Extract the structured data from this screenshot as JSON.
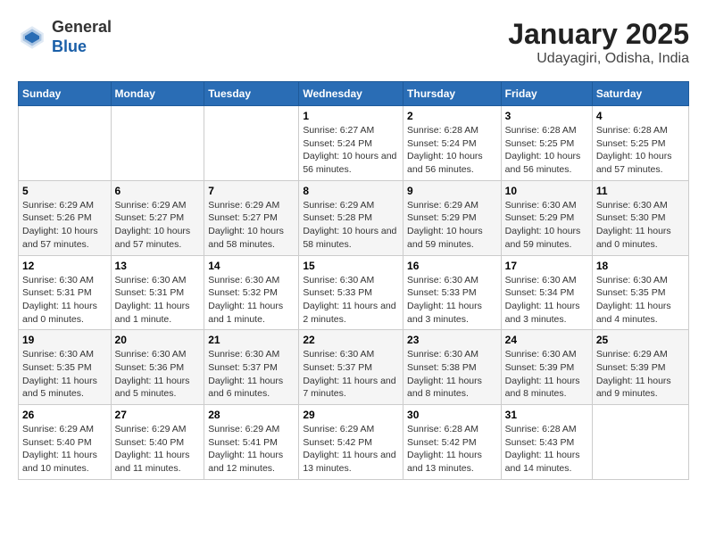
{
  "header": {
    "logo_line1": "General",
    "logo_line2": "Blue",
    "title": "January 2025",
    "subtitle": "Udayagiri, Odisha, India"
  },
  "weekdays": [
    "Sunday",
    "Monday",
    "Tuesday",
    "Wednesday",
    "Thursday",
    "Friday",
    "Saturday"
  ],
  "weeks": [
    [
      {
        "day": "",
        "info": ""
      },
      {
        "day": "",
        "info": ""
      },
      {
        "day": "",
        "info": ""
      },
      {
        "day": "1",
        "info": "Sunrise: 6:27 AM\nSunset: 5:24 PM\nDaylight: 10 hours and 56 minutes."
      },
      {
        "day": "2",
        "info": "Sunrise: 6:28 AM\nSunset: 5:24 PM\nDaylight: 10 hours and 56 minutes."
      },
      {
        "day": "3",
        "info": "Sunrise: 6:28 AM\nSunset: 5:25 PM\nDaylight: 10 hours and 56 minutes."
      },
      {
        "day": "4",
        "info": "Sunrise: 6:28 AM\nSunset: 5:25 PM\nDaylight: 10 hours and 57 minutes."
      }
    ],
    [
      {
        "day": "5",
        "info": "Sunrise: 6:29 AM\nSunset: 5:26 PM\nDaylight: 10 hours and 57 minutes."
      },
      {
        "day": "6",
        "info": "Sunrise: 6:29 AM\nSunset: 5:27 PM\nDaylight: 10 hours and 57 minutes."
      },
      {
        "day": "7",
        "info": "Sunrise: 6:29 AM\nSunset: 5:27 PM\nDaylight: 10 hours and 58 minutes."
      },
      {
        "day": "8",
        "info": "Sunrise: 6:29 AM\nSunset: 5:28 PM\nDaylight: 10 hours and 58 minutes."
      },
      {
        "day": "9",
        "info": "Sunrise: 6:29 AM\nSunset: 5:29 PM\nDaylight: 10 hours and 59 minutes."
      },
      {
        "day": "10",
        "info": "Sunrise: 6:30 AM\nSunset: 5:29 PM\nDaylight: 10 hours and 59 minutes."
      },
      {
        "day": "11",
        "info": "Sunrise: 6:30 AM\nSunset: 5:30 PM\nDaylight: 11 hours and 0 minutes."
      }
    ],
    [
      {
        "day": "12",
        "info": "Sunrise: 6:30 AM\nSunset: 5:31 PM\nDaylight: 11 hours and 0 minutes."
      },
      {
        "day": "13",
        "info": "Sunrise: 6:30 AM\nSunset: 5:31 PM\nDaylight: 11 hours and 1 minute."
      },
      {
        "day": "14",
        "info": "Sunrise: 6:30 AM\nSunset: 5:32 PM\nDaylight: 11 hours and 1 minute."
      },
      {
        "day": "15",
        "info": "Sunrise: 6:30 AM\nSunset: 5:33 PM\nDaylight: 11 hours and 2 minutes."
      },
      {
        "day": "16",
        "info": "Sunrise: 6:30 AM\nSunset: 5:33 PM\nDaylight: 11 hours and 3 minutes."
      },
      {
        "day": "17",
        "info": "Sunrise: 6:30 AM\nSunset: 5:34 PM\nDaylight: 11 hours and 3 minutes."
      },
      {
        "day": "18",
        "info": "Sunrise: 6:30 AM\nSunset: 5:35 PM\nDaylight: 11 hours and 4 minutes."
      }
    ],
    [
      {
        "day": "19",
        "info": "Sunrise: 6:30 AM\nSunset: 5:35 PM\nDaylight: 11 hours and 5 minutes."
      },
      {
        "day": "20",
        "info": "Sunrise: 6:30 AM\nSunset: 5:36 PM\nDaylight: 11 hours and 5 minutes."
      },
      {
        "day": "21",
        "info": "Sunrise: 6:30 AM\nSunset: 5:37 PM\nDaylight: 11 hours and 6 minutes."
      },
      {
        "day": "22",
        "info": "Sunrise: 6:30 AM\nSunset: 5:37 PM\nDaylight: 11 hours and 7 minutes."
      },
      {
        "day": "23",
        "info": "Sunrise: 6:30 AM\nSunset: 5:38 PM\nDaylight: 11 hours and 8 minutes."
      },
      {
        "day": "24",
        "info": "Sunrise: 6:30 AM\nSunset: 5:39 PM\nDaylight: 11 hours and 8 minutes."
      },
      {
        "day": "25",
        "info": "Sunrise: 6:29 AM\nSunset: 5:39 PM\nDaylight: 11 hours and 9 minutes."
      }
    ],
    [
      {
        "day": "26",
        "info": "Sunrise: 6:29 AM\nSunset: 5:40 PM\nDaylight: 11 hours and 10 minutes."
      },
      {
        "day": "27",
        "info": "Sunrise: 6:29 AM\nSunset: 5:40 PM\nDaylight: 11 hours and 11 minutes."
      },
      {
        "day": "28",
        "info": "Sunrise: 6:29 AM\nSunset: 5:41 PM\nDaylight: 11 hours and 12 minutes."
      },
      {
        "day": "29",
        "info": "Sunrise: 6:29 AM\nSunset: 5:42 PM\nDaylight: 11 hours and 13 minutes."
      },
      {
        "day": "30",
        "info": "Sunrise: 6:28 AM\nSunset: 5:42 PM\nDaylight: 11 hours and 13 minutes."
      },
      {
        "day": "31",
        "info": "Sunrise: 6:28 AM\nSunset: 5:43 PM\nDaylight: 11 hours and 14 minutes."
      },
      {
        "day": "",
        "info": ""
      }
    ]
  ]
}
